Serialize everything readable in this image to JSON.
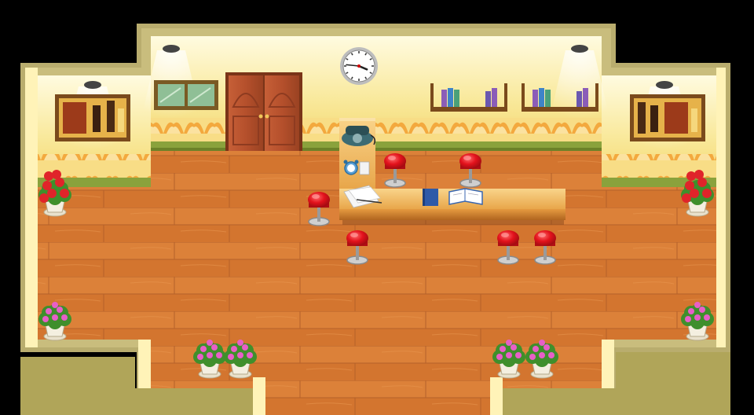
{
  "scene": {
    "room": "game-room-interior",
    "colors": {
      "outer_wall": "#b9ad6e",
      "outer_wall_dark": "#9d9357",
      "floor": "#d97c35",
      "floor_light": "#e69549",
      "floor_dark": "#b8612a",
      "wall_top": "#fff5c0",
      "wall_mid": "#f7e28b",
      "wallpaper_orange": "#f0a53d",
      "baseboard_green": "#8aa23c",
      "door": "#b8532f",
      "door_dark": "#8e3b20",
      "counter": "#e9a649",
      "counter_dark": "#b86e2a",
      "stool_red": "#e3121c",
      "plant_green": "#3f8f2c",
      "flower_pink": "#e85fc8",
      "flower_red": "#e0242a"
    },
    "clock": {
      "hour": 3,
      "minute": 46
    },
    "bookshelves": [
      {
        "books": [
          "#8b5db8",
          "#3e84c8",
          "#4aa07a",
          "#6a58b0",
          "#8b5db8"
        ]
      },
      {
        "books": [
          "#8b5db8",
          "#3e84c8",
          "#4aa07a",
          "#6a58b0",
          "#8b5db8"
        ]
      }
    ],
    "icons": {
      "clock": "wall-clock-icon",
      "phone": "rotary-phone-icon",
      "alarm": "alarm-clock-icon",
      "papers": "papers-icon",
      "book": "closed-book-icon",
      "open_book": "open-book-icon"
    }
  }
}
